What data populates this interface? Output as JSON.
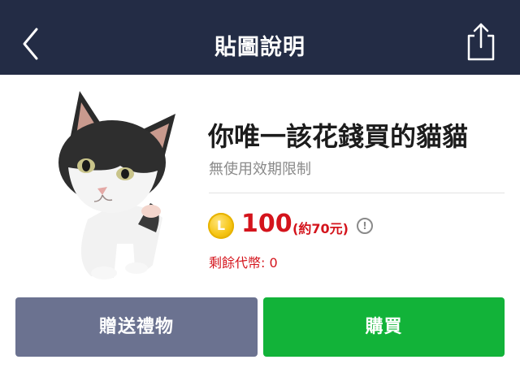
{
  "header": {
    "title": "貼圖說明",
    "back_icon": "chevron-left-icon",
    "share_icon": "share-icon"
  },
  "product": {
    "name": "你唯一該花錢買的貓貓",
    "validity": "無使用效期限制",
    "coin_letter": "L",
    "price": "100",
    "price_approx": "(約70元)",
    "info_symbol": "!",
    "balance": "剩餘代幣: 0"
  },
  "actions": {
    "gift_label": "贈送禮物",
    "buy_label": "購買"
  },
  "colors": {
    "header_bg": "#232c45",
    "price_red": "#d4141c",
    "gift_button": "#6b7290",
    "buy_button": "#12b339",
    "coin_gold": "#f6c514"
  }
}
